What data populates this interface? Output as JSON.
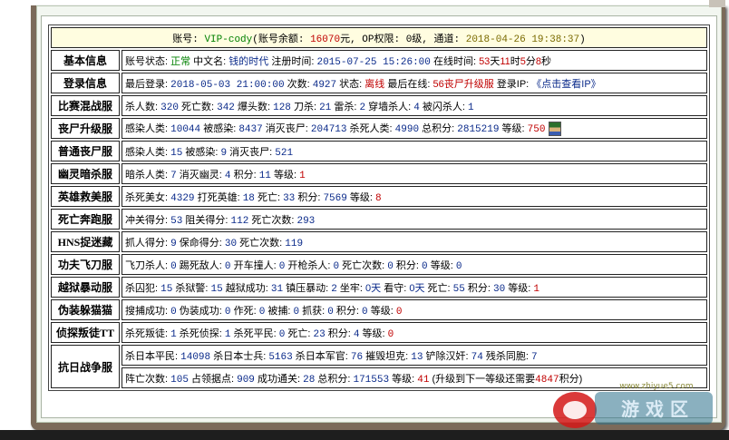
{
  "header": {
    "account_label": "账号: ",
    "account": "VIP-cody",
    "balance_label": "(账号余额: ",
    "balance": "16070",
    "balance_unit": "元, OP权限: ",
    "op": "0级",
    "channel_label": ", 通道: ",
    "datetime": "2018-04-26 19:38:37",
    "close": ")"
  },
  "rows": {
    "basic": {
      "label": "基本信息",
      "status_label": "账号状态: ",
      "status": "正常",
      "cn_label": " 中文名: ",
      "cn_name": "钱的时代",
      "reg_label": " 注册时间: ",
      "reg_time": "2015-07-25 15:26:00",
      "online_label": " 在线时间: ",
      "online_days": "53",
      "days_unit": "天",
      "online_hours": "11",
      "hours_unit": "时",
      "online_mins": "5",
      "mins_unit": "分",
      "online_secs": "8",
      "secs_unit": "秒"
    },
    "login": {
      "label": "登录信息",
      "last_label": "最后登录: ",
      "last": "2018-05-03 21:00:00",
      "count_label": " 次数: ",
      "count": "4927",
      "state_label": " 状态: ",
      "state": "离线",
      "last_online_label": " 最后在线: ",
      "last_online": "56丧尸升级服",
      "ip_label": " 登录IP: ",
      "ip_link": "《点击查看IP》"
    },
    "race": {
      "label": "比赛混战服",
      "kills_l": "杀人数: ",
      "kills": "320",
      "deaths_l": " 死亡数: ",
      "deaths": "342",
      "hs_l": " 爆头数: ",
      "hs": "128",
      "knife_l": " 刀杀: ",
      "knife": "21",
      "thunder_l": " 雷杀: ",
      "thunder": "2",
      "wall_l": " 穿墙杀人: ",
      "wall": "4",
      "flash_l": " 被闪杀人: ",
      "flash": "1"
    },
    "zombie_up": {
      "label": "丧尸升级服",
      "infect_l": "感染人类: ",
      "infect": "10044",
      "infected_l": " 被感染: ",
      "infected": "8437",
      "destroy_l": " 消灭丧尸: ",
      "destroy": "204713",
      "kill_h_l": " 杀死人类: ",
      "kill_h": "4990",
      "total_l": " 总积分: ",
      "total": "2815219",
      "level_l": " 等级: ",
      "level": "750"
    },
    "zombie_normal": {
      "label": "普通丧尸服",
      "infect_l": "感染人类: ",
      "infect": "15",
      "infected_l": " 被感染: ",
      "infected": "9",
      "destroy_l": " 消灭丧尸: ",
      "destroy": "521"
    },
    "ghost": {
      "label": "幽灵暗杀服",
      "assassin_l": "暗杀人类: ",
      "assassin": "7",
      "ghost_l": " 消灭幽灵: ",
      "ghost": "4",
      "points_l": " 积分: ",
      "points": "11",
      "level_l": " 等级: ",
      "level": "1"
    },
    "hero": {
      "label": "英雄救美服",
      "beauty_l": "杀死美女: ",
      "beauty": "4329",
      "hero_l": " 打死英雄: ",
      "hero": "18",
      "death_l": " 死亡: ",
      "death": "33",
      "points_l": " 积分: ",
      "points": "7569",
      "level_l": " 等级: ",
      "level": "8"
    },
    "run": {
      "label": "死亡奔跑服",
      "pass_l": "冲关得分: ",
      "pass": "53",
      "block_l": " 阻关得分: ",
      "block": "112",
      "death_l": " 死亡次数: ",
      "death": "293"
    },
    "hns": {
      "label": "HNS捉迷藏",
      "catch_l": "抓人得分: ",
      "catch": "9",
      "save_l": " 保命得分: ",
      "save": "30",
      "death_l": " 死亡次数: ",
      "death": "119"
    },
    "kungfu": {
      "label": "功夫飞刀服",
      "knife_l": "飞刀杀人: ",
      "knife": "0",
      "kick_l": " 踢死敌人: ",
      "kick": "0",
      "car_l": " 开车撞人: ",
      "car": "0",
      "gun_l": " 开枪杀人: ",
      "gun": "0",
      "death_l": " 死亡次数: ",
      "death": "0",
      "points_l": " 积分: ",
      "points": "0",
      "level_l": " 等级: ",
      "level": "0"
    },
    "prison": {
      "label": "越狱暴动服",
      "prisoner_l": "杀囚犯: ",
      "prisoner": "15",
      "guard_l": " 杀狱警: ",
      "guard": "15",
      "escape_l": " 越狱成功: ",
      "escape": "31",
      "riot_l": " 镇压暴动: ",
      "riot": "2",
      "jail_l": " 坐牢: ",
      "jail": "0天",
      "watch_l": " 看守: ",
      "watch": "0天",
      "death_l": " 死亡: ",
      "death": "55",
      "points_l": " 积分: ",
      "points": "30",
      "level_l": " 等级: ",
      "level": "1"
    },
    "disguise": {
      "label": "伪装躲猫猫",
      "search_l": "搜捕成功: ",
      "search": "0",
      "disguise_l": " 伪装成功: ",
      "disguise": "0",
      "bad_l": " 作死: ",
      "bad": "0",
      "caught_l": " 被捕: ",
      "caught": "0",
      "capture_l": " 抓获: ",
      "capture": "0",
      "points_l": " 积分: ",
      "points": "0",
      "level_l": " 等级: ",
      "level": "0"
    },
    "detective": {
      "label": "侦探叛徒TT",
      "traitor_l": "杀死叛徒: ",
      "traitor": "1",
      "detective_l": " 杀死侦探: ",
      "detective": "1",
      "civ_l": " 杀死平民: ",
      "civ": "0",
      "death_l": " 死亡: ",
      "death": "23",
      "points_l": " 积分: ",
      "points": "4",
      "level_l": " 等级: ",
      "level": "0"
    },
    "war": {
      "label": "抗日战争服",
      "civ_l": "杀日本平民: ",
      "civ": "14098",
      "soldier_l": " 杀日本士兵: ",
      "soldier": "5163",
      "officer_l": " 杀日本军官: ",
      "officer": "76",
      "tank_l": " 摧毁坦克: ",
      "tank": "13",
      "traitor_l": " 铲除汉奸: ",
      "traitor": "74",
      "ally_l": " 残杀同胞: ",
      "ally": "7",
      "death_l": "阵亡次数: ",
      "death": "105",
      "occupy_l": " 占领据点: ",
      "occupy": "909",
      "pass_l": " 成功通关: ",
      "pass": "28",
      "total_l": " 总积分: ",
      "total": "171553",
      "level_l": " 等级: ",
      "level": "41",
      "next_l": " (升级到下一等级还需要",
      "next": "4847",
      "next_unit": "积分)"
    }
  },
  "watermark": {
    "text": "www.zhiyue5.com"
  },
  "colors": {
    "label_purple": "#7a0f8a",
    "value_blue": "#0a2a8a",
    "value_red": "#c00000",
    "value_green": "#008000",
    "header_bg": "#fffde0",
    "frame": "#7b6a5a"
  }
}
